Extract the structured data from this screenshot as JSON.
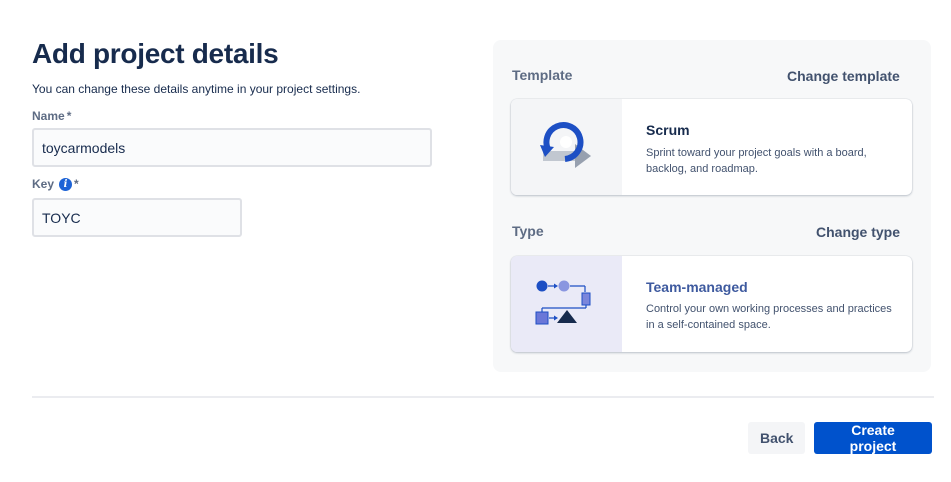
{
  "header": {
    "title": "Add project details",
    "subtitle": "You can change these details anytime in your project settings."
  },
  "form": {
    "name_label": "Name",
    "name_value": "toycarmodels",
    "key_label": "Key",
    "key_value": "TOYC",
    "required_marker": "*",
    "info_glyph": "i"
  },
  "panel": {
    "template_label": "Template",
    "change_template": "Change template",
    "template": {
      "title": "Scrum",
      "description": "Sprint toward your project goals with a board, backlog, and roadmap.",
      "icon": "scrum-cycle-icon"
    },
    "type_label": "Type",
    "change_type": "Change type",
    "type": {
      "title": "Team-managed",
      "description": "Control your own working processes and practices in a self-contained space.",
      "icon": "team-managed-flow-icon"
    }
  },
  "footer": {
    "back_label": "Back",
    "create_label": "Create project"
  },
  "colors": {
    "primary": "#0052cc",
    "heading": "#172b4d",
    "type_title": "#3e5a9f",
    "illustration_bg_type": "#eaeaf7"
  }
}
